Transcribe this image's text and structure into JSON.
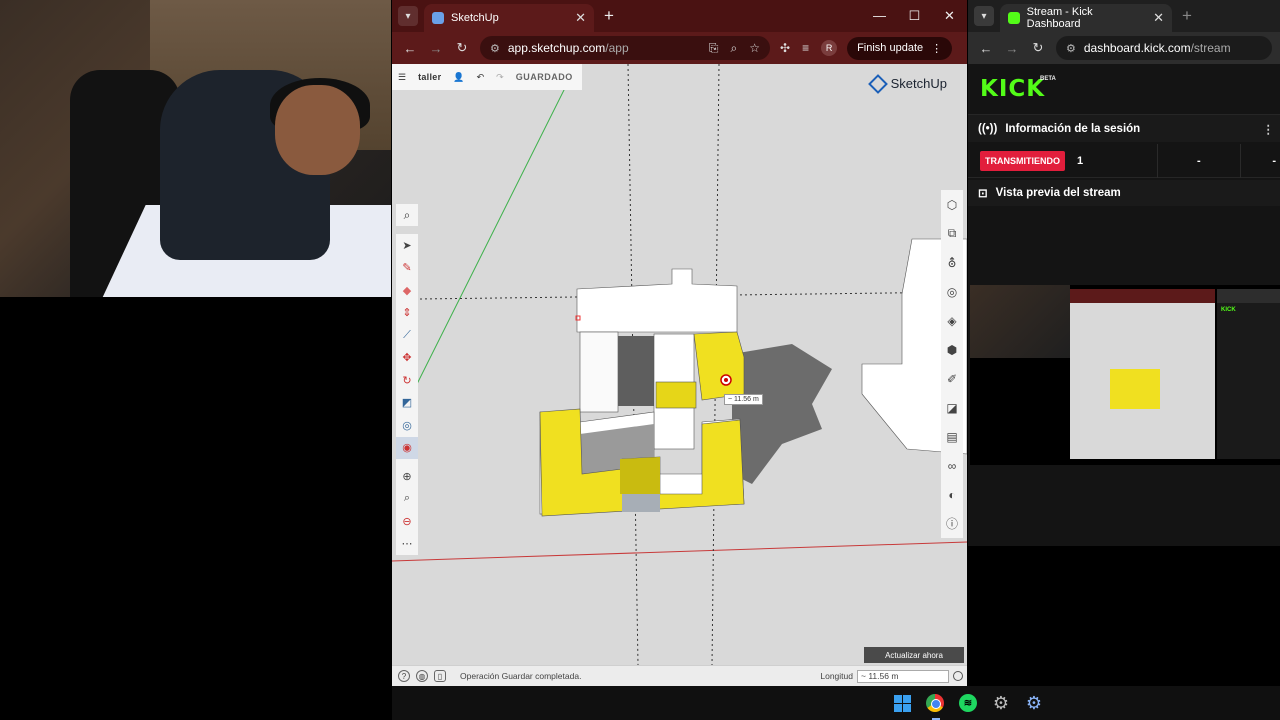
{
  "sketchup_tab": {
    "title": "SketchUp",
    "url_host": "app.sketchup.com",
    "url_path": "/app",
    "finish_update": "Finish update",
    "avatar": "R"
  },
  "sketchup_app": {
    "file_name": "taller",
    "saved_label": "GUARDADO",
    "brand": "SketchUp",
    "measure_tip": "~ 11.56 m",
    "update_now": "Actualizar ahora",
    "status_message": "Operación Guardar completada.",
    "length_label": "Longitud",
    "length_value": "~ 11.56 m"
  },
  "kick_tab": {
    "title": "Stream - Kick Dashboard",
    "url_host": "dashboard.kick.com",
    "url_path": "/stream"
  },
  "kick": {
    "logo": "KICK",
    "beta": "BETA",
    "session_title": "Información de la sesión",
    "live_badge": "TRANSMITIENDO",
    "viewers": "1",
    "stat2": "-",
    "stat3": "-",
    "preview_title": "Vista previa del stream",
    "preview_logo": "KICK"
  },
  "colors": {
    "sketchup_accent": "#5c1a1a",
    "kick_green": "#53fc18",
    "live_red": "#e21e3c",
    "model_yellow": "#f0e020"
  }
}
